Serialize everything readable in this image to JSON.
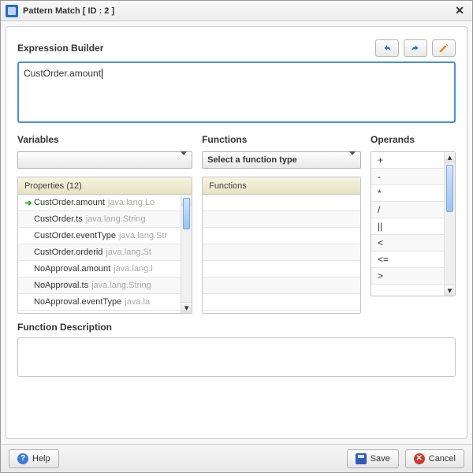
{
  "title": "Pattern Match [ ID : 2 ]",
  "expression_builder": {
    "label": "Expression Builder",
    "value": "CustOrder.amount"
  },
  "variables": {
    "label": "Variables",
    "properties_header": "Properties (12)",
    "items": [
      {
        "name": "CustOrder.amount",
        "type": "java.lang.Lo",
        "selected": true
      },
      {
        "name": "CustOrder.ts",
        "type": "java.lang.String",
        "selected": false
      },
      {
        "name": "CustOrder.eventType",
        "type": "java.lang.Str",
        "selected": false
      },
      {
        "name": "CustOrder.orderid",
        "type": "java.lang.St",
        "selected": false
      },
      {
        "name": "NoApproval.amount",
        "type": "java.lang.l",
        "selected": false
      },
      {
        "name": "NoApproval.ts",
        "type": "java.lang.String",
        "selected": false
      },
      {
        "name": "NoApproval.eventType",
        "type": "java.la",
        "selected": false
      }
    ]
  },
  "functions": {
    "label": "Functions",
    "select_placeholder": "Select a function type",
    "list_header": "Functions"
  },
  "operands": {
    "label": "Operands",
    "items": [
      "+",
      "-",
      "*",
      "/",
      "||",
      "<",
      "<=",
      ">"
    ]
  },
  "function_description_label": "Function Description",
  "footer": {
    "help": "Help",
    "save": "Save",
    "cancel": "Cancel"
  }
}
